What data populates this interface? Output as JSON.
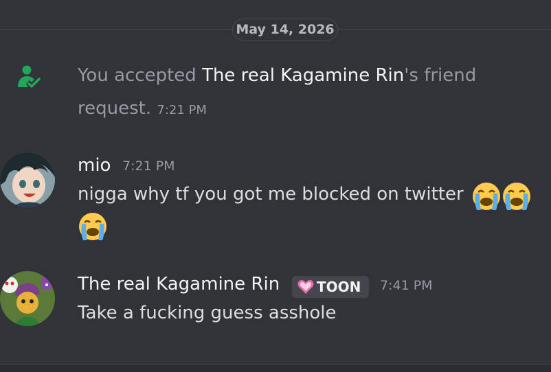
{
  "date_divider": "May 14, 2026",
  "system_message": {
    "prefix": "You accepted ",
    "name": "The real Kagamine Rin",
    "suffix": "'s friend request.",
    "time": "7:21 PM",
    "icon": "friend-accepted-icon"
  },
  "messages": [
    {
      "author": "mio",
      "time": "7:21 PM",
      "text": "nigga why tf you got me blocked on twitter",
      "emoji": "loudly-crying-face"
    },
    {
      "author": "The real Kagamine Rin",
      "tag": "TOON",
      "tag_icon": "pink-heart-icon",
      "time": "7:41 PM",
      "text": "Take a fucking guess asshole"
    }
  ],
  "colors": {
    "background": "#323339",
    "muted_text": "#949ba4",
    "primary_text": "#f2f3f5",
    "accept_icon": "#23a55a"
  }
}
